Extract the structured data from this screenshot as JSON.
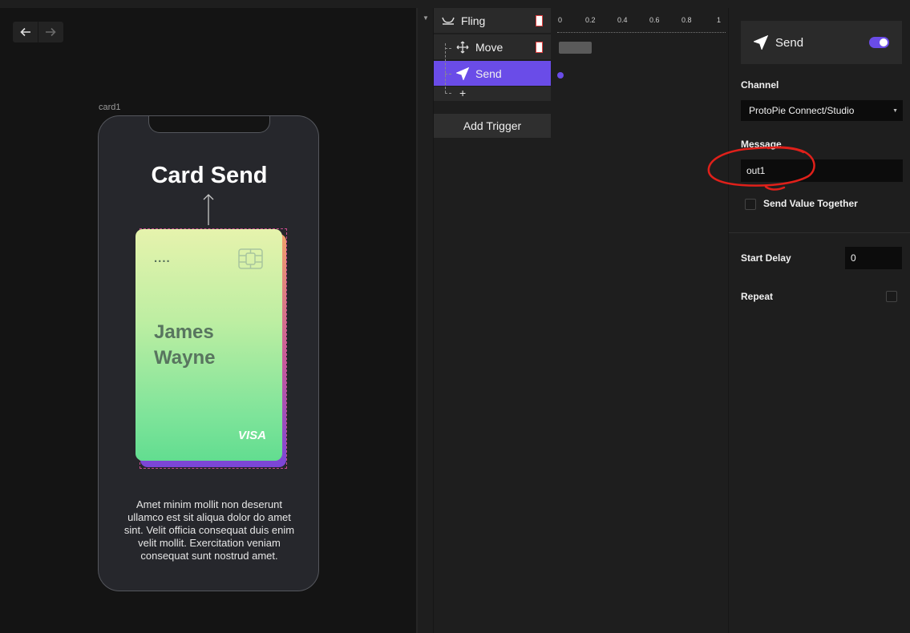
{
  "canvas": {
    "frame_label": "card1",
    "phone": {
      "title": "Card Send",
      "card": {
        "dots": "....",
        "name_line1": "James",
        "name_line2": "Wayne",
        "brand": "VISA"
      },
      "body_text": "Amet minim mollit non deserunt ullamco est sit aliqua dolor do amet sint. Velit officia consequat duis enim velit mollit. Exercitation veniam consequat sunt nostrud amet."
    }
  },
  "interactions": {
    "tree": [
      {
        "label": "Fling",
        "icon": "fling-icon"
      },
      {
        "label": "Move",
        "icon": "move-icon"
      },
      {
        "label": "Send",
        "icon": "send-icon",
        "selected": true
      }
    ],
    "add_symbol": "+",
    "add_trigger_label": "Add Trigger",
    "timeline_ticks": [
      "0",
      "0.2",
      "0.4",
      "0.6",
      "0.8",
      "1"
    ]
  },
  "properties": {
    "header_title": "Send",
    "enabled": true,
    "channel_label": "Channel",
    "channel_value": "ProtoPie Connect/Studio",
    "message_label": "Message",
    "message_value": "out1",
    "send_value_together_label": "Send Value Together",
    "start_delay_label": "Start Delay",
    "start_delay_value": "0",
    "repeat_label": "Repeat"
  },
  "colors": {
    "accent": "#6a4ce8",
    "annotation": "#e0201a",
    "panel": "#1e1e1e"
  }
}
